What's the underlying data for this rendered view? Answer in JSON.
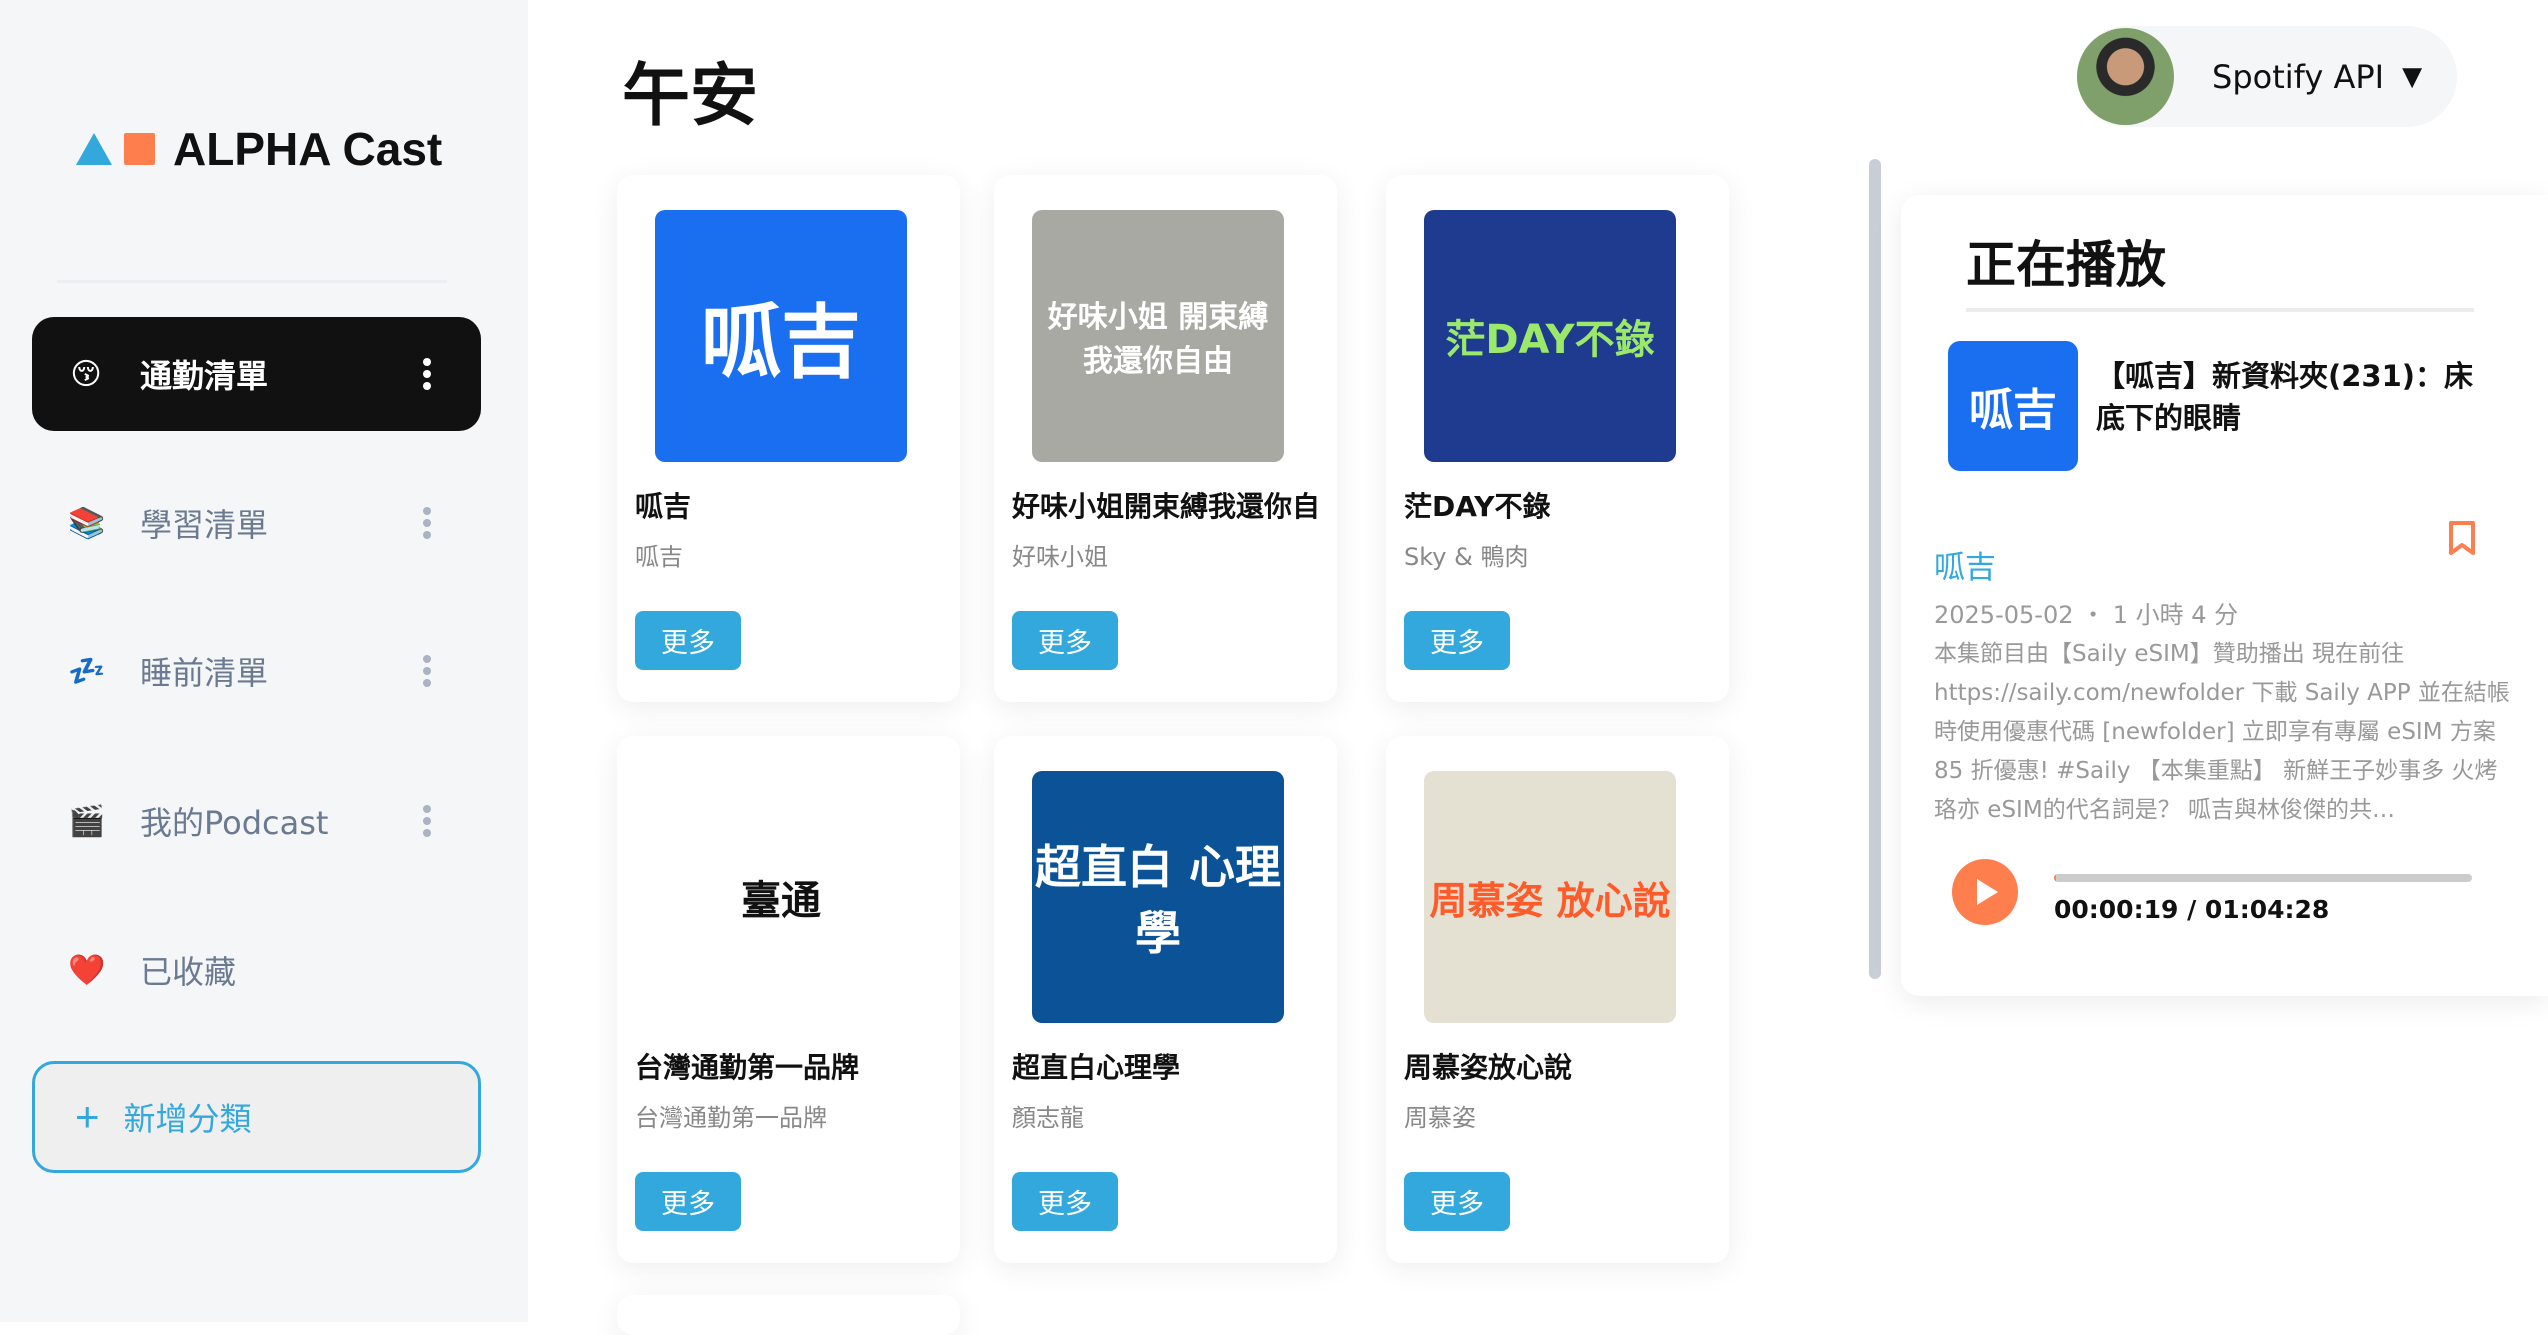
{
  "app": {
    "logo_text": "ALPHA Cast"
  },
  "sidebar": {
    "items": [
      {
        "icon": "😚",
        "label": "通勤清單",
        "active": true
      },
      {
        "icon": "📚",
        "label": "學習清單"
      },
      {
        "icon": "💤",
        "label": "睡前清單"
      },
      {
        "icon": "🎬",
        "label": "我的Podcast"
      },
      {
        "icon": "❤️",
        "label": "已收藏"
      }
    ],
    "add_label": "新增分類",
    "add_icon": "+"
  },
  "header": {
    "greeting": "午安",
    "account": "Spotify API",
    "chevron": "⌄"
  },
  "podcasts": [
    {
      "title": "呱吉",
      "author": "呱吉",
      "cover_text": "呱吉",
      "more": "更多"
    },
    {
      "title": "好味小姐開束縛我還你自由",
      "author": "好味小姐",
      "cover_text": "好味小姐 開束縛 我還你自由",
      "more": "更多"
    },
    {
      "title": "茫DAY不錄",
      "author": "Sky & 鴨肉",
      "cover_text": "茫DAY不錄",
      "more": "更多"
    },
    {
      "title": "台灣通勤第一品牌",
      "author": "台灣通勤第一品牌",
      "cover_text": "臺通",
      "more": "更多"
    },
    {
      "title": "超直白心理學",
      "author": "顏志龍",
      "cover_text": "超直白 心理學",
      "more": "更多"
    },
    {
      "title": "周慕姿放心說",
      "author": "周慕姿",
      "cover_text": "周慕姿 放心說",
      "more": "更多"
    }
  ],
  "player": {
    "heading": "正在播放",
    "cover_text": "呱吉",
    "episode_title": "【呱吉】新資料夾(231)：床底下的眼睛",
    "show": "呱吉",
    "meta": "2025-05-02 ・ 1 小時 4 分",
    "description": "本集節目由【Saily eSIM】贊助播出 現在前往 https://saily.com/newfolder 下載 Saily APP 並在結帳時使用優惠代碼 [newfolder] 立即享有專屬 eSIM 方案 85 折優惠! #Saily 【本集重點】 新鮮王子妙事多 火烤珞亦 eSIM的代名詞是？ 呱吉與林俊傑的共…",
    "time": "00:00:19 / 01:04:28",
    "progress_percent": 0.5
  },
  "colors": {
    "accent": "#33a8dd",
    "orange": "#ff7e4e"
  }
}
